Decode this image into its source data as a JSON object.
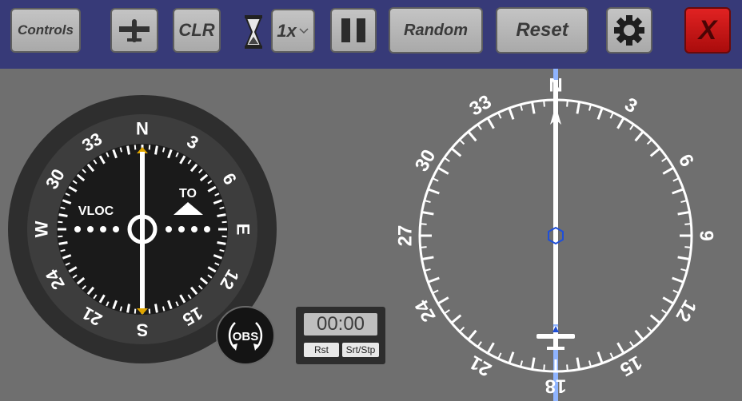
{
  "toolbar": {
    "controls_label": "Controls",
    "clr_label": "CLR",
    "speed_label": "1x",
    "random_label": "Random",
    "reset_label": "Reset",
    "close_label": "X",
    "icons": [
      "airplane-icon",
      "hourglass-icon",
      "chevron-down-icon",
      "pause-icon",
      "gear-icon"
    ]
  },
  "vor_indicator": {
    "compass_labels": [
      "N",
      "3",
      "6",
      "E",
      "12",
      "15",
      "S",
      "21",
      "24",
      "W",
      "30",
      "33"
    ],
    "vloc_label": "VLOC",
    "to_from_label": "TO",
    "obs_label": "OBS"
  },
  "timer": {
    "display": "00:00",
    "reset_label": "Rst",
    "start_stop_label": "Srt/Stp"
  },
  "hsi": {
    "compass_labels": [
      "N",
      "3",
      "6",
      "9",
      "12",
      "15",
      "18",
      "21",
      "24",
      "27",
      "30",
      "33"
    ]
  },
  "colors": {
    "toolbar_bg": "#373a78",
    "background": "#6f6f6f",
    "close_button": "#c81616",
    "course_line": "#8fb4ff",
    "marker": "#e0a600"
  }
}
